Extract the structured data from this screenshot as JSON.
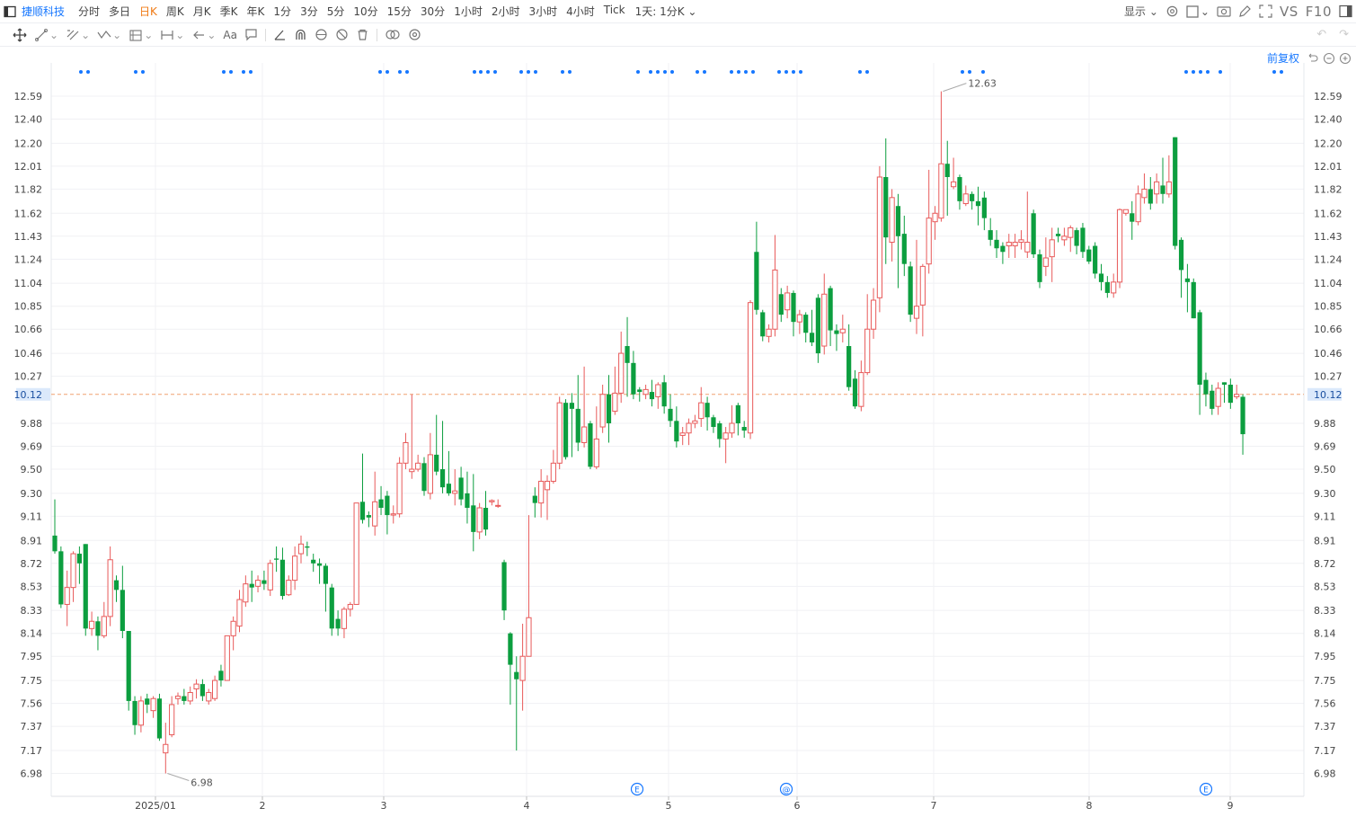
{
  "toolbar": {
    "stock_name": "捷顺科技",
    "periods": [
      "分时",
      "多日",
      "日K",
      "周K",
      "月K",
      "季K",
      "年K",
      "1分",
      "3分",
      "5分",
      "10分",
      "15分",
      "30分",
      "1小时",
      "2小时",
      "3小时",
      "4小时",
      "Tick"
    ],
    "active_period": "日K",
    "aggregation": "1天: 1分K",
    "display_label": "显示",
    "vs_label": "VS",
    "f10_label": "F10",
    "text_tool": "Aa"
  },
  "adjust": {
    "label": "前复权"
  },
  "colors": {
    "up": "#e85a5a",
    "down": "#0c9e3f",
    "price_line": "#f0a070",
    "price_badge": "#dbe9fb",
    "marker": "#1677ff",
    "grid": "#f0f1f4"
  },
  "chart_data": {
    "type": "candlestick",
    "y_ticks": [
      "12.59",
      "12.40",
      "12.20",
      "12.01",
      "11.82",
      "11.62",
      "11.43",
      "11.24",
      "11.04",
      "10.85",
      "10.66",
      "10.46",
      "10.27",
      "10.12",
      "9.88",
      "9.69",
      "9.50",
      "9.30",
      "9.11",
      "8.91",
      "8.72",
      "8.53",
      "8.33",
      "8.14",
      "7.95",
      "7.75",
      "7.56",
      "7.37",
      "7.17",
      "6.98"
    ],
    "x_labels": [
      "2025/01",
      "2",
      "3",
      "4",
      "5",
      "6",
      "7",
      "8",
      "9"
    ],
    "current_price": "10.12",
    "high_label": "12.63",
    "low_label": "6.98",
    "event_markers": [
      "E",
      "@",
      "E"
    ],
    "candles": [
      [
        8.95,
        8.82,
        9.25,
        8.8
      ],
      [
        8.82,
        8.38,
        8.86,
        8.35
      ],
      [
        8.38,
        8.52,
        8.66,
        8.2
      ],
      [
        8.52,
        8.8,
        8.82,
        8.4
      ],
      [
        8.8,
        8.72,
        8.86,
        8.55
      ],
      [
        8.88,
        8.18,
        8.88,
        8.12
      ],
      [
        8.18,
        8.24,
        8.32,
        8.12
      ],
      [
        8.24,
        8.12,
        8.28,
        8.0
      ],
      [
        8.12,
        8.28,
        8.4,
        8.1
      ],
      [
        8.28,
        8.75,
        8.86,
        8.2
      ],
      [
        8.58,
        8.5,
        8.62,
        8.4
      ],
      [
        8.5,
        8.16,
        8.7,
        8.1
      ],
      [
        8.16,
        7.58,
        8.16,
        7.5
      ],
      [
        7.58,
        7.38,
        7.62,
        7.3
      ],
      [
        7.38,
        7.58,
        7.62,
        7.32
      ],
      [
        7.6,
        7.55,
        7.64,
        7.48
      ],
      [
        7.5,
        7.6,
        7.62,
        7.44
      ],
      [
        7.6,
        7.27,
        7.64,
        7.25
      ],
      [
        7.15,
        7.22,
        7.4,
        6.98
      ],
      [
        7.3,
        7.55,
        7.62,
        7.28
      ],
      [
        7.6,
        7.62,
        7.65,
        7.55
      ],
      [
        7.62,
        7.58,
        7.68,
        7.55
      ],
      [
        7.58,
        7.65,
        7.7,
        7.55
      ],
      [
        7.68,
        7.72,
        7.76,
        7.6
      ],
      [
        7.72,
        7.62,
        7.76,
        7.58
      ],
      [
        7.58,
        7.65,
        7.68,
        7.55
      ],
      [
        7.6,
        7.75,
        7.79,
        7.58
      ],
      [
        7.83,
        7.75,
        7.88,
        7.7
      ],
      [
        7.75,
        8.12,
        8.12,
        7.75
      ],
      [
        8.12,
        8.24,
        8.28,
        8.0
      ],
      [
        8.2,
        8.42,
        8.5,
        8.15
      ],
      [
        8.4,
        8.55,
        8.62,
        8.36
      ],
      [
        8.55,
        8.52,
        8.66,
        8.4
      ],
      [
        8.53,
        8.58,
        8.62,
        8.48
      ],
      [
        8.58,
        8.55,
        8.66,
        8.5
      ],
      [
        8.5,
        8.72,
        8.75,
        8.45
      ],
      [
        8.76,
        8.75,
        8.86,
        8.65
      ],
      [
        8.75,
        8.45,
        8.85,
        8.42
      ],
      [
        8.46,
        8.58,
        8.62,
        8.45
      ],
      [
        8.58,
        8.78,
        8.86,
        8.5
      ],
      [
        8.8,
        8.88,
        8.95,
        8.72
      ],
      [
        8.86,
        8.85,
        8.9,
        8.78
      ],
      [
        8.75,
        8.72,
        8.8,
        8.65
      ],
      [
        8.72,
        8.7,
        8.76,
        8.55
      ],
      [
        8.7,
        8.55,
        8.72,
        8.32
      ],
      [
        8.52,
        8.18,
        8.55,
        8.12
      ],
      [
        8.26,
        8.18,
        8.33,
        8.12
      ],
      [
        8.18,
        8.34,
        8.36,
        8.1
      ],
      [
        8.34,
        8.38,
        8.4,
        8.28
      ],
      [
        8.38,
        9.22,
        9.22,
        8.38
      ],
      [
        9.23,
        9.08,
        9.63,
        9.05
      ],
      [
        9.12,
        9.1,
        9.15,
        9.02
      ],
      [
        9.03,
        9.23,
        9.48,
        8.95
      ],
      [
        9.25,
        9.18,
        9.36,
        9.12
      ],
      [
        9.28,
        9.12,
        9.32,
        8.96
      ],
      [
        9.12,
        9.13,
        9.2,
        9.05
      ],
      [
        9.13,
        9.55,
        9.6,
        9.1
      ],
      [
        9.55,
        9.72,
        9.8,
        9.5
      ],
      [
        9.48,
        9.5,
        10.12,
        9.42
      ],
      [
        9.5,
        9.55,
        9.62,
        9.48
      ],
      [
        9.55,
        9.32,
        9.6,
        9.28
      ],
      [
        9.3,
        9.62,
        9.8,
        9.25
      ],
      [
        9.62,
        9.48,
        9.95,
        9.45
      ],
      [
        9.5,
        9.35,
        9.9,
        9.3
      ],
      [
        9.38,
        9.3,
        9.65,
        9.28
      ],
      [
        9.3,
        9.32,
        9.5,
        9.2
      ],
      [
        9.43,
        9.25,
        9.52,
        9.2
      ],
      [
        9.3,
        9.18,
        9.48,
        9.05
      ],
      [
        9.2,
        8.98,
        9.46,
        8.82
      ],
      [
        8.98,
        9.18,
        9.22,
        8.92
      ],
      [
        9.18,
        9.0,
        9.32,
        8.95
      ],
      [
        9.23,
        9.24,
        9.25,
        9.2
      ],
      [
        9.2,
        9.2,
        9.25,
        9.18
      ],
      [
        8.73,
        8.33,
        8.75,
        8.25
      ],
      [
        8.14,
        7.88,
        8.15,
        7.55
      ],
      [
        7.82,
        7.76,
        7.95,
        7.17
      ],
      [
        7.75,
        7.95,
        8.22,
        7.5
      ],
      [
        7.95,
        8.27,
        9.12,
        7.95
      ],
      [
        9.28,
        9.22,
        9.35,
        9.1
      ],
      [
        9.22,
        9.4,
        9.5,
        9.1
      ],
      [
        9.33,
        9.4,
        9.45,
        9.08
      ],
      [
        9.4,
        9.55,
        9.66,
        9.38
      ],
      [
        9.55,
        10.05,
        10.1,
        9.5
      ],
      [
        10.05,
        9.6,
        10.08,
        9.58
      ],
      [
        10.05,
        10.0,
        10.13,
        9.6
      ],
      [
        10.0,
        9.72,
        10.28,
        9.65
      ],
      [
        9.72,
        9.85,
        10.35,
        9.68
      ],
      [
        9.88,
        9.52,
        9.9,
        9.5
      ],
      [
        9.52,
        9.75,
        10.02,
        9.5
      ],
      [
        9.85,
        10.12,
        10.2,
        9.8
      ],
      [
        10.12,
        9.88,
        10.28,
        9.72
      ],
      [
        9.98,
        10.13,
        10.35,
        9.95
      ],
      [
        10.13,
        10.46,
        10.64,
        10.05
      ],
      [
        10.52,
        10.38,
        10.76,
        10.1
      ],
      [
        10.38,
        10.12,
        10.48,
        10.08
      ],
      [
        10.16,
        10.14,
        10.18,
        10.06
      ],
      [
        10.12,
        10.16,
        10.2,
        10.08
      ],
      [
        10.14,
        10.08,
        10.24,
        10.02
      ],
      [
        10.1,
        10.2,
        10.22,
        10.0
      ],
      [
        10.22,
        10.02,
        10.28,
        9.96
      ],
      [
        10.0,
        9.9,
        10.12,
        9.85
      ],
      [
        9.9,
        9.73,
        10.02,
        9.68
      ],
      [
        9.78,
        9.8,
        9.85,
        9.7
      ],
      [
        9.8,
        9.88,
        9.92,
        9.7
      ],
      [
        9.88,
        9.9,
        9.95,
        9.84
      ],
      [
        9.92,
        10.05,
        10.18,
        9.85
      ],
      [
        10.05,
        9.93,
        10.1,
        9.82
      ],
      [
        9.93,
        9.85,
        9.95,
        9.8
      ],
      [
        9.88,
        9.75,
        9.9,
        9.68
      ],
      [
        9.75,
        9.8,
        9.85,
        9.55
      ],
      [
        9.8,
        9.88,
        10.03,
        9.76
      ],
      [
        10.03,
        9.88,
        10.05,
        9.78
      ],
      [
        9.85,
        9.82,
        9.9,
        9.76
      ],
      [
        9.8,
        10.88,
        10.9,
        9.75
      ],
      [
        11.3,
        10.82,
        11.55,
        10.78
      ],
      [
        10.8,
        10.6,
        10.82,
        10.56
      ],
      [
        10.6,
        10.66,
        10.7,
        10.55
      ],
      [
        10.66,
        11.15,
        11.44,
        10.6
      ],
      [
        10.95,
        10.78,
        11.0,
        10.72
      ],
      [
        10.82,
        10.96,
        11.02,
        10.75
      ],
      [
        10.96,
        10.72,
        10.98,
        10.6
      ],
      [
        10.72,
        10.78,
        10.82,
        10.62
      ],
      [
        10.78,
        10.63,
        10.8,
        10.55
      ],
      [
        10.63,
        10.55,
        10.82,
        10.52
      ],
      [
        10.92,
        10.46,
        10.95,
        10.38
      ],
      [
        10.52,
        10.95,
        11.12,
        10.45
      ],
      [
        11.0,
        10.65,
        11.02,
        10.52
      ],
      [
        10.65,
        10.62,
        10.7,
        10.48
      ],
      [
        10.63,
        10.66,
        10.78,
        10.55
      ],
      [
        10.52,
        10.18,
        10.7,
        10.15
      ],
      [
        10.25,
        10.02,
        10.32,
        10.0
      ],
      [
        10.02,
        10.3,
        10.4,
        9.98
      ],
      [
        10.3,
        10.66,
        10.95,
        10.28
      ],
      [
        10.66,
        10.9,
        11.0,
        10.58
      ],
      [
        10.92,
        11.92,
        12.01,
        10.8
      ],
      [
        11.92,
        11.42,
        12.24,
        11.2
      ],
      [
        11.38,
        11.75,
        11.82,
        11.22
      ],
      [
        11.68,
        11.43,
        11.78,
        11.0
      ],
      [
        11.45,
        11.2,
        11.6,
        11.1
      ],
      [
        11.18,
        10.78,
        11.22,
        10.72
      ],
      [
        10.75,
        10.85,
        11.4,
        10.62
      ],
      [
        10.86,
        11.18,
        11.2,
        10.6
      ],
      [
        11.2,
        11.58,
        11.98,
        11.12
      ],
      [
        11.55,
        11.62,
        11.68,
        11.4
      ],
      [
        11.58,
        12.03,
        12.63,
        11.55
      ],
      [
        12.03,
        11.92,
        12.22,
        11.6
      ],
      [
        11.84,
        11.88,
        12.08,
        11.82
      ],
      [
        11.92,
        11.72,
        11.94,
        11.65
      ],
      [
        11.7,
        11.78,
        11.85,
        11.68
      ],
      [
        11.78,
        11.72,
        11.8,
        11.65
      ],
      [
        11.72,
        11.68,
        11.84,
        11.52
      ],
      [
        11.75,
        11.58,
        11.8,
        11.48
      ],
      [
        11.48,
        11.4,
        11.58,
        11.35
      ],
      [
        11.4,
        11.33,
        11.48,
        11.25
      ],
      [
        11.35,
        11.3,
        11.38,
        11.2
      ],
      [
        11.35,
        11.38,
        11.45,
        11.25
      ],
      [
        11.35,
        11.38,
        11.45,
        11.25
      ],
      [
        11.38,
        11.4,
        11.48,
        11.32
      ],
      [
        11.3,
        11.38,
        11.8,
        11.25
      ],
      [
        11.62,
        11.28,
        11.65,
        11.25
      ],
      [
        11.28,
        11.05,
        11.32,
        11.0
      ],
      [
        11.18,
        11.25,
        11.42,
        11.1
      ],
      [
        11.26,
        11.4,
        11.5,
        11.05
      ],
      [
        11.45,
        11.43,
        11.5,
        11.38
      ],
      [
        11.4,
        11.43,
        11.5,
        11.35
      ],
      [
        11.42,
        11.5,
        11.52,
        11.3
      ],
      [
        11.48,
        11.35,
        11.5,
        11.28
      ],
      [
        11.5,
        11.3,
        11.54,
        11.25
      ],
      [
        11.32,
        11.22,
        11.35,
        11.2
      ],
      [
        11.35,
        11.12,
        11.38,
        11.08
      ],
      [
        11.12,
        11.05,
        11.2,
        10.98
      ],
      [
        11.05,
        10.96,
        11.1,
        10.92
      ],
      [
        10.96,
        11.05,
        11.12,
        10.92
      ],
      [
        11.05,
        11.65,
        11.66,
        11.0
      ],
      [
        11.62,
        11.65,
        11.65,
        11.6
      ],
      [
        11.62,
        11.55,
        11.72,
        11.4
      ],
      [
        11.55,
        11.78,
        11.85,
        11.52
      ],
      [
        11.75,
        11.82,
        11.95,
        11.7
      ],
      [
        11.82,
        11.7,
        11.92,
        11.65
      ],
      [
        11.78,
        11.88,
        11.95,
        11.7
      ],
      [
        11.85,
        11.78,
        12.08,
        11.7
      ],
      [
        11.78,
        11.88,
        12.1,
        11.75
      ],
      [
        12.25,
        11.35,
        12.25,
        11.32
      ],
      [
        11.4,
        11.15,
        11.42,
        10.92
      ],
      [
        11.08,
        11.05,
        11.2,
        10.8
      ],
      [
        11.05,
        10.75,
        11.08,
        10.75
      ],
      [
        10.8,
        10.2,
        10.82,
        9.95
      ],
      [
        10.24,
        10.12,
        10.3,
        10.02
      ],
      [
        10.15,
        10.0,
        10.2,
        9.95
      ],
      [
        10.02,
        10.17,
        10.22,
        9.95
      ],
      [
        10.22,
        10.2,
        10.22,
        10.05
      ],
      [
        10.2,
        10.05,
        10.25,
        10.0
      ],
      [
        10.1,
        10.12,
        10.2,
        10.08
      ],
      [
        10.1,
        9.79,
        10.12,
        9.62
      ]
    ]
  }
}
